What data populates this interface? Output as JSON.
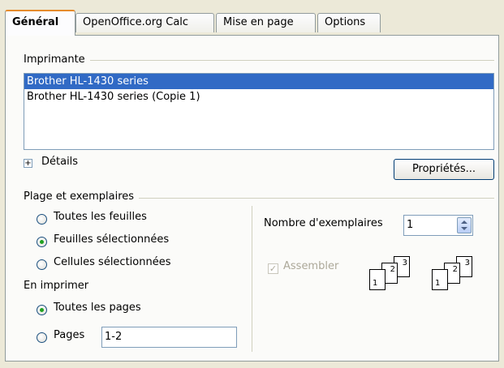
{
  "tabs": [
    {
      "label": "Général",
      "active": true
    },
    {
      "label": "OpenOffice.org Calc",
      "active": false
    },
    {
      "label": "Mise en page",
      "active": false
    },
    {
      "label": "Options",
      "active": false
    }
  ],
  "printer": {
    "section_label": "Imprimante",
    "items": [
      {
        "label": "Brother HL-1430 series",
        "selected": true
      },
      {
        "label": "Brother HL-1430 series (Copie 1)",
        "selected": false
      }
    ],
    "details_label": "Détails",
    "expand_glyph": "+",
    "properties_button": "Propriétés..."
  },
  "range": {
    "section_label": "Plage et exemplaires",
    "options": [
      {
        "label": "Toutes les feuilles",
        "selected": false
      },
      {
        "label": "Feuilles sélectionnées",
        "selected": true
      },
      {
        "label": "Cellules sélectionnées",
        "selected": false
      }
    ],
    "print_label": "En imprimer",
    "print_options": [
      {
        "label": "Toutes les pages",
        "selected": true
      },
      {
        "label": "Pages",
        "selected": false
      }
    ],
    "pages_value": "1-2"
  },
  "copies": {
    "label": "Nombre d'exemplaires",
    "value": "1",
    "collate_label": "Assembler",
    "collate_checked": true,
    "collate_disabled": true,
    "check_glyph": "✓",
    "page_numbers": [
      "1",
      "2",
      "3"
    ]
  },
  "colors": {
    "accent": "#e68b2c",
    "selection": "#316ac5",
    "radio_dot": "#21a121",
    "disabled_text": "#aca899"
  }
}
